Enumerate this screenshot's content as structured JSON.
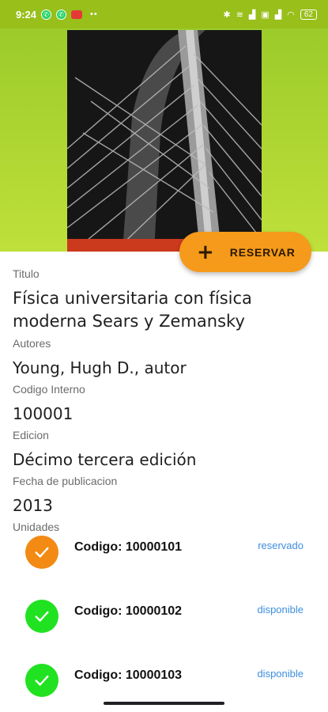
{
  "status_bar": {
    "time": "9:24",
    "battery": "62",
    "background": "#98bf1a"
  },
  "fab": {
    "icon": "plus-icon",
    "label": "RESERVAR",
    "color": "#f59a1b"
  },
  "book": {
    "title_label": "Titulo",
    "title": "Física universitaria con física moderna Sears y Zemansky",
    "authors_label": "Autores",
    "authors": "Young, Hugh D., autor",
    "code_label": "Codigo Interno",
    "code": "100001",
    "edition_label": "Edicion",
    "edition": "Décimo tercera edición",
    "pub_date_label": "Fecha de publicacion",
    "pub_date": "2013",
    "units_label": "Unidades"
  },
  "units": [
    {
      "code": "Codigo: 10000101",
      "status": "reservado",
      "icon": "check-icon",
      "color": "#f28a13"
    },
    {
      "code": "Codigo: 10000102",
      "status": "disponible",
      "icon": "check-icon",
      "color": "#21e221"
    },
    {
      "code": "Codigo: 10000103",
      "status": "disponible",
      "icon": "check-icon",
      "color": "#21e221"
    }
  ]
}
